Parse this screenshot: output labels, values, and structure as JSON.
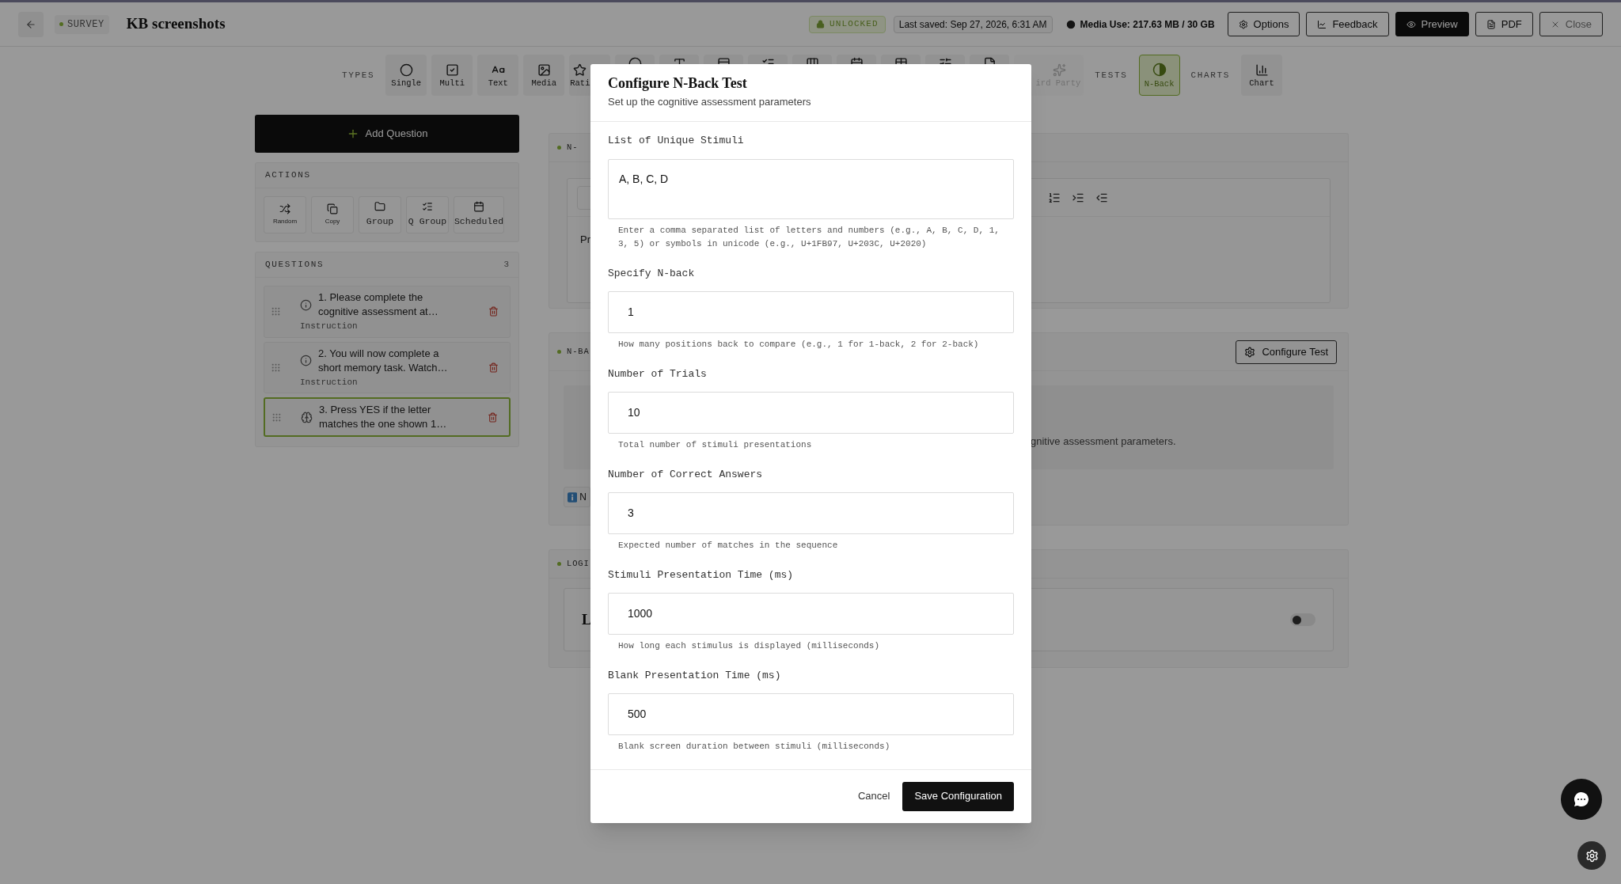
{
  "header": {
    "section_badge": "SURVEY",
    "title": "KB screenshots",
    "lock_status": "UNLOCKED",
    "last_saved": "Last saved: Sep 27, 2026, 6:31 AM",
    "media_use": "Media Use: 217.63 MB / 30 GB",
    "buttons": [
      {
        "label": "Options",
        "kind": "outline"
      },
      {
        "label": "Feedback",
        "kind": "outline"
      },
      {
        "label": "Preview",
        "kind": "primary"
      },
      {
        "label": "PDF",
        "kind": "outline"
      },
      {
        "label": "Close",
        "kind": "muted"
      }
    ]
  },
  "toolbar": [
    {
      "kind": "label",
      "text": "TYPES"
    },
    {
      "kind": "button",
      "label": "Single",
      "selected": false,
      "disabled": false
    },
    {
      "kind": "button",
      "label": "Multi",
      "selected": false,
      "disabled": false
    },
    {
      "kind": "button",
      "label": "Text",
      "selected": false,
      "disabled": false
    },
    {
      "kind": "button",
      "label": "Media",
      "selected": false,
      "disabled": false
    },
    {
      "kind": "button",
      "label": "Rati",
      "selected": false,
      "disabled": false
    },
    {
      "kind": "covered"
    },
    {
      "kind": "covered"
    },
    {
      "kind": "covered"
    },
    {
      "kind": "covered"
    },
    {
      "kind": "covered"
    },
    {
      "kind": "covered"
    },
    {
      "kind": "covered"
    },
    {
      "kind": "covered"
    },
    {
      "kind": "covered"
    },
    {
      "kind": "button",
      "label": "ird Party",
      "selected": false,
      "disabled": true
    },
    {
      "kind": "label",
      "text": "TESTS"
    },
    {
      "kind": "button",
      "label": "N-Back",
      "selected": true,
      "disabled": false
    },
    {
      "kind": "label",
      "text": "CHARTS"
    },
    {
      "kind": "button",
      "label": "Chart",
      "selected": false,
      "disabled": false
    }
  ],
  "sidebar": {
    "add_button": "Add Question",
    "actions": {
      "title": "ACTIONS",
      "items": [
        {
          "label": "Random",
          "kind": "compact"
        },
        {
          "label": "Copy",
          "kind": "compact"
        },
        {
          "label": "Group",
          "kind": "regular"
        },
        {
          "label": "Q Group",
          "kind": "regular"
        },
        {
          "label": "Scheduled",
          "kind": "regular"
        }
      ]
    },
    "questions": {
      "title": "QUESTIONS",
      "count": "3",
      "items": [
        {
          "text": "1. Please complete the cognitive assessment at…",
          "type": "Instruction",
          "kind": "instruction",
          "selected": false
        },
        {
          "text": "2. You will now complete a short memory task. Watch…",
          "type": "Instruction",
          "kind": "instruction",
          "selected": false
        },
        {
          "text": "3. Press YES if the letter matches the one shown 1…",
          "kind": "nback",
          "selected": true
        }
      ]
    }
  },
  "main": {
    "cards": [
      {
        "kind": "editor",
        "header": "N-",
        "body_text": "Pr"
      },
      {
        "kind": "test",
        "header": "N-BA",
        "button": "Configure Test",
        "body_text": "gnitive assessment parameters.",
        "badge": "N"
      },
      {
        "kind": "logic",
        "header": "LOGI",
        "body_title": "L",
        "on": false
      }
    ]
  },
  "dialog": {
    "title": "Configure N-Back Test",
    "subtitle": "Set up the cognitive assessment parameters",
    "fields": [
      {
        "kind": "textarea",
        "label": "List of Unique Stimuli",
        "value": "A, B, C, D",
        "help": "Enter a comma separated list of letters and numbers (e.g., A, B, C, D, 1, 3, 5) or symbols in unicode (e.g., U+1FB97, U+203C, U+2020)"
      },
      {
        "kind": "number",
        "label": "Specify N-back",
        "value": "1",
        "help": "How many positions back to compare (e.g., 1 for 1-back, 2 for 2-back)"
      },
      {
        "kind": "number",
        "label": "Number of Trials",
        "value": "10",
        "help": "Total number of stimuli presentations"
      },
      {
        "kind": "number",
        "label": "Number of Correct Answers",
        "value": "3",
        "help": "Expected number of matches in the sequence"
      },
      {
        "kind": "number",
        "label": "Stimuli Presentation Time (ms)",
        "value": "1000",
        "help": "How long each stimulus is displayed (milliseconds)"
      },
      {
        "kind": "number",
        "label": "Blank Presentation Time (ms)",
        "value": "500",
        "help": "Blank screen duration between stimuli (milliseconds)"
      }
    ],
    "buttons": [
      {
        "label": "Cancel",
        "kind": "ghost"
      },
      {
        "label": "Save Configuration",
        "kind": "primary"
      }
    ]
  }
}
